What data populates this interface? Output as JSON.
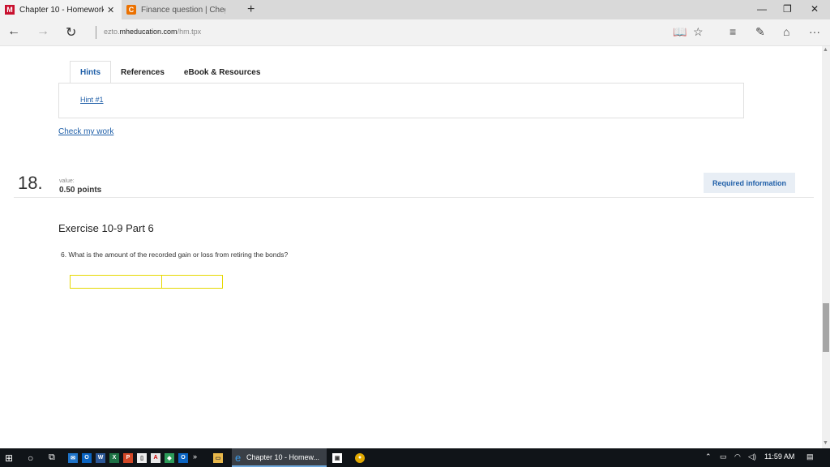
{
  "browser": {
    "tabs": [
      {
        "title": "Chapter 10 - Homework",
        "favicon": "M",
        "close": "✕"
      },
      {
        "title": "Finance question | Chegg.com",
        "favicon": "C"
      }
    ],
    "newtab": "+",
    "window_controls": {
      "minimize": "—",
      "restore": "❐",
      "close": "✕"
    },
    "address": {
      "prefix": "ezto.",
      "domain": "mheducation.com",
      "path": "/hm.tpx"
    }
  },
  "page": {
    "tabs": [
      "Hints",
      "References",
      "eBook & Resources"
    ],
    "hint_link": "Hint #1",
    "check_link": "Check my work",
    "question_number": "18.",
    "value_label": "value:",
    "value_points": "0.50 points",
    "required_button": "Required information",
    "exercise_title": "Exercise 10-9 Part 6",
    "question_text": "6. What is the amount of the recorded gain or loss from retiring the bonds?",
    "answer_fields": [
      "",
      ""
    ]
  },
  "taskbar": {
    "active_app": "Chapter 10 - Homew...",
    "overflow": "»",
    "clock": "11:59 AM",
    "app_letters": [
      "O",
      "W",
      "X",
      "P",
      "O"
    ]
  }
}
